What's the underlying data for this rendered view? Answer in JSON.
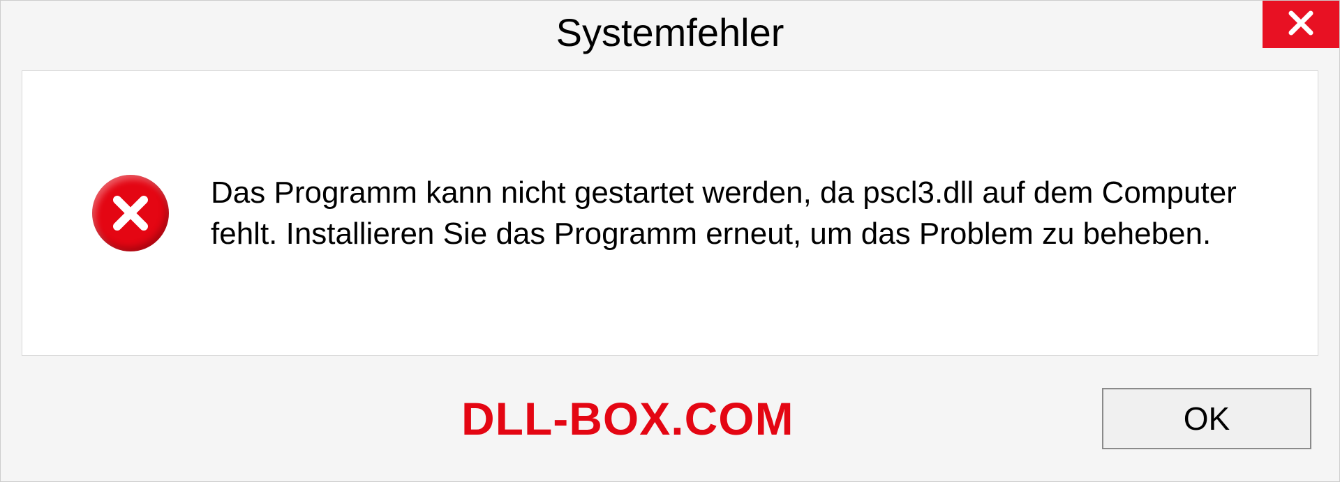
{
  "dialog": {
    "title": "Systemfehler",
    "message": "Das Programm kann nicht gestartet werden, da pscl3.dll auf dem Computer fehlt. Installieren Sie das Programm erneut, um das Problem zu beheben.",
    "ok_label": "OK"
  },
  "watermark": "DLL-BOX.COM"
}
